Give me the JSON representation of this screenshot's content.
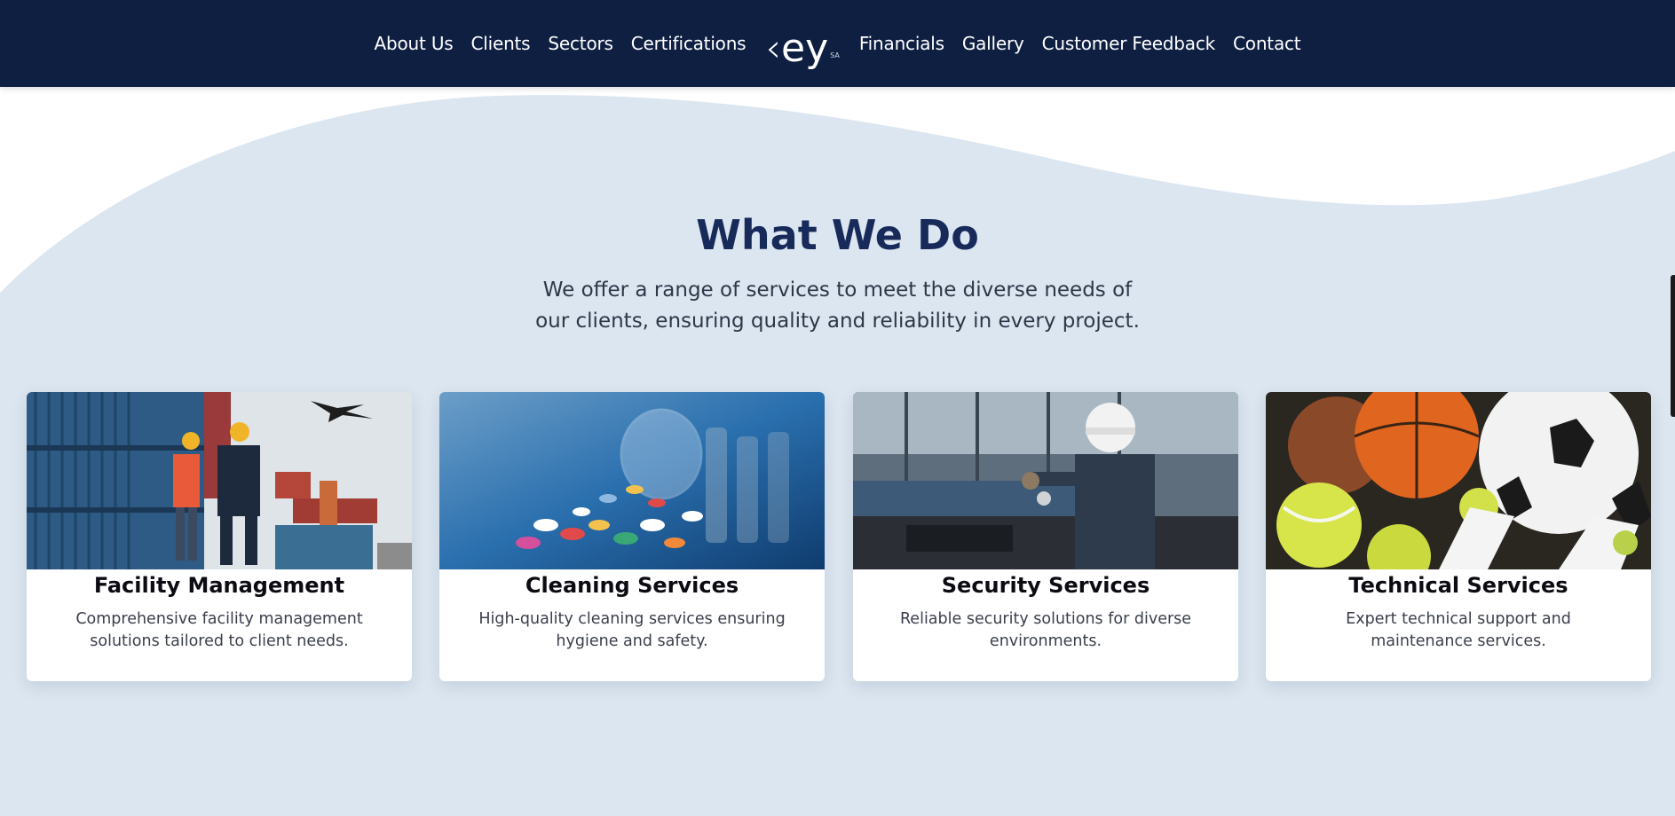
{
  "header": {
    "nav_left": [
      "About Us",
      "Clients",
      "Sectors",
      "Certifications"
    ],
    "nav_right": [
      "Financials",
      "Gallery",
      "Customer Feedback",
      "Contact"
    ],
    "logo_text": "ey",
    "logo_chevron": "‹",
    "logo_suffix": "SA"
  },
  "section": {
    "title": "What We Do",
    "subtitle": "We offer a range of services to meet the diverse needs of our clients, ensuring quality and reliability in every project."
  },
  "services": [
    {
      "title": "Facility Management",
      "description": "Comprehensive facility management solutions tailored to client needs."
    },
    {
      "title": "Cleaning Services",
      "description": "High-quality cleaning services ensuring hygiene and safety."
    },
    {
      "title": "Security Services",
      "description": "Reliable security solutions for diverse environments."
    },
    {
      "title": "Technical Services",
      "description": "Expert technical support and maintenance services."
    }
  ],
  "colors": {
    "header_bg": "#0f1f42",
    "section_bg": "#dce6f0",
    "title": "#172a5a"
  }
}
